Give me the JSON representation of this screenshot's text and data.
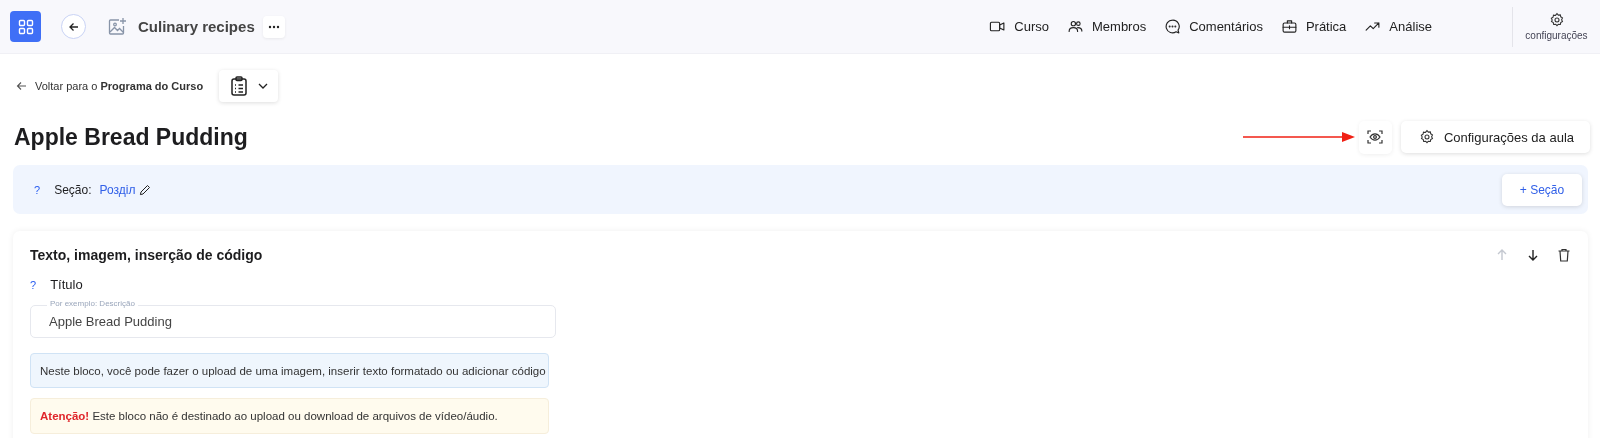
{
  "topbar": {
    "title": "Culinary recipes",
    "nav": [
      {
        "label": "Curso"
      },
      {
        "label": "Membros"
      },
      {
        "label": "Comentários"
      },
      {
        "label": "Prática"
      },
      {
        "label": "Análise"
      }
    ],
    "settings": "configurações"
  },
  "breadcrumb": {
    "prefix": "Voltar para o ",
    "target": "Programa do Curso"
  },
  "lesson": {
    "title": "Apple Bread Pudding",
    "settings_button": "Configurações da aula"
  },
  "section": {
    "help": "?",
    "label": "Seção:",
    "value": "Розділ",
    "add_button": "+ Seção"
  },
  "block": {
    "title": "Texto, imagem, inserção de código",
    "move": [
      {
        "disabled": true
      },
      {
        "disabled": false
      }
    ],
    "field": {
      "help": "?",
      "label": "Título",
      "placeholder": "Por exemplo: Descrição",
      "value": "Apple Bread Pudding"
    },
    "info": "Neste bloco, você pode fazer o upload de uma imagem, inserir texto formatado ou adicionar código",
    "warning": "**Atenção!** Este bloco não é destinado ao upload ou download de arquivos de vídeo/áudio."
  }
}
